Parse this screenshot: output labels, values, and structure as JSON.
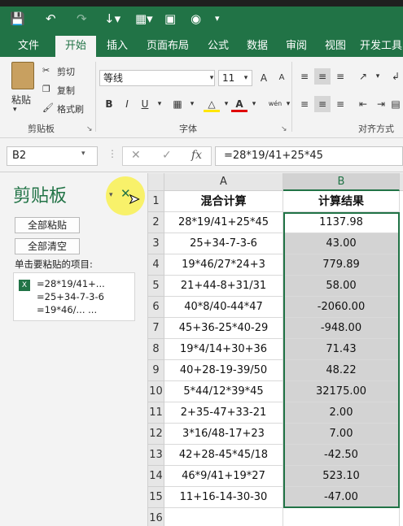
{
  "tabs": [
    "文件",
    "开始",
    "插入",
    "页面布局",
    "公式",
    "数据",
    "审阅",
    "视图",
    "开发工具"
  ],
  "active_tab": "开始",
  "ribbon": {
    "clipboard": {
      "paste": "粘贴",
      "cut": "剪切",
      "copy": "复制",
      "format_painter": "格式刷",
      "title": "剪贴板"
    },
    "font": {
      "name": "等线",
      "size": "11",
      "grow": "A",
      "shrink": "A",
      "bold": "B",
      "italic": "I",
      "underline": "U",
      "wen": "wén",
      "title": "字体"
    },
    "alignment": {
      "title": "对齐方式"
    }
  },
  "formula_bar": {
    "name_box": "B2",
    "fx": "fx",
    "formula": "=28*19/41+25*45"
  },
  "clipboard_pane": {
    "title": "剪贴板",
    "paste_all": "全部粘贴",
    "clear_all": "全部清空",
    "prompt": "单击要粘贴的项目:",
    "item_lines": [
      "=28*19/41+...",
      "=25+34-7-3-6",
      "=19*46/...      ..."
    ]
  },
  "sheet": {
    "columns": [
      "A",
      "B"
    ],
    "rows": [
      {
        "n": "1",
        "a": "混合计算",
        "b": "计算结果"
      },
      {
        "n": "2",
        "a": "28*19/41+25*45",
        "b": "1137.98"
      },
      {
        "n": "3",
        "a": "25+34-7-3-6",
        "b": "43.00"
      },
      {
        "n": "4",
        "a": "19*46/27*24+3",
        "b": "779.89"
      },
      {
        "n": "5",
        "a": "21+44-8+31/31",
        "b": "58.00"
      },
      {
        "n": "6",
        "a": "40*8/40-44*47",
        "b": "-2060.00"
      },
      {
        "n": "7",
        "a": "45+36-25*40-29",
        "b": "-948.00"
      },
      {
        "n": "8",
        "a": "19*4/14+30+36",
        "b": "71.43"
      },
      {
        "n": "9",
        "a": "40+28-19-39/50",
        "b": "48.22"
      },
      {
        "n": "10",
        "a": "5*44/12*39*45",
        "b": "32175.00"
      },
      {
        "n": "11",
        "a": "2+35-47+33-21",
        "b": "2.00"
      },
      {
        "n": "12",
        "a": "3*16/48-17+23",
        "b": "7.00"
      },
      {
        "n": "13",
        "a": "42+28-45*45/18",
        "b": "-42.50"
      },
      {
        "n": "14",
        "a": "46*9/41+19*27",
        "b": "523.10"
      },
      {
        "n": "15",
        "a": "11+16-14-30-30",
        "b": "-47.00"
      },
      {
        "n": "16",
        "a": "",
        "b": ""
      }
    ]
  },
  "colors": {
    "accent": "#217346",
    "selection": "#d3d3d3",
    "highlight": "#faf03c"
  }
}
